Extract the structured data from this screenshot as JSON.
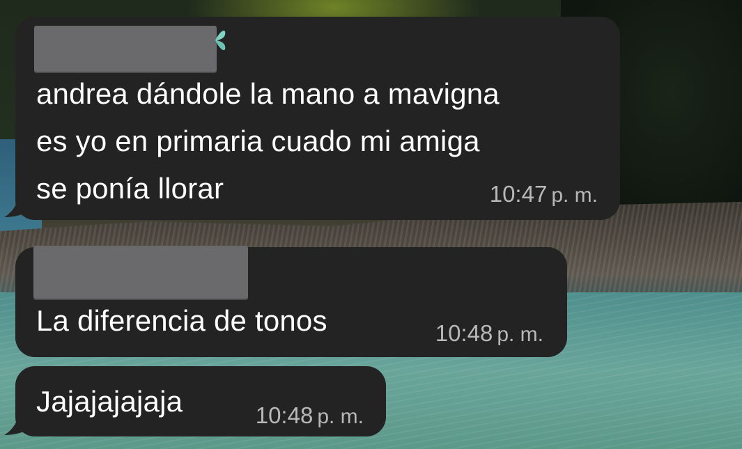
{
  "messages": [
    {
      "sender_redacted": true,
      "sender_emoji": "butterfly",
      "lines": [
        "andrea dándole la mano a  mavigna",
        "es yo en primaria cuado mi amiga",
        "se ponía llorar"
      ],
      "time": "10:47",
      "time_suffix": "p. m."
    },
    {
      "sender_redacted": true,
      "lines": [
        "La diferencia de tonos"
      ],
      "time": "10:48",
      "time_suffix": "p. m."
    },
    {
      "lines": [
        "Jajajajajaja"
      ],
      "time": "10:48",
      "time_suffix": "p. m."
    }
  ],
  "colors": {
    "bubble_bg": "#232323",
    "text": "#ffffff",
    "time_text": "#b8b8b8",
    "redaction": "#6a6a6c",
    "emoji_accent": "#7fd3c4"
  }
}
